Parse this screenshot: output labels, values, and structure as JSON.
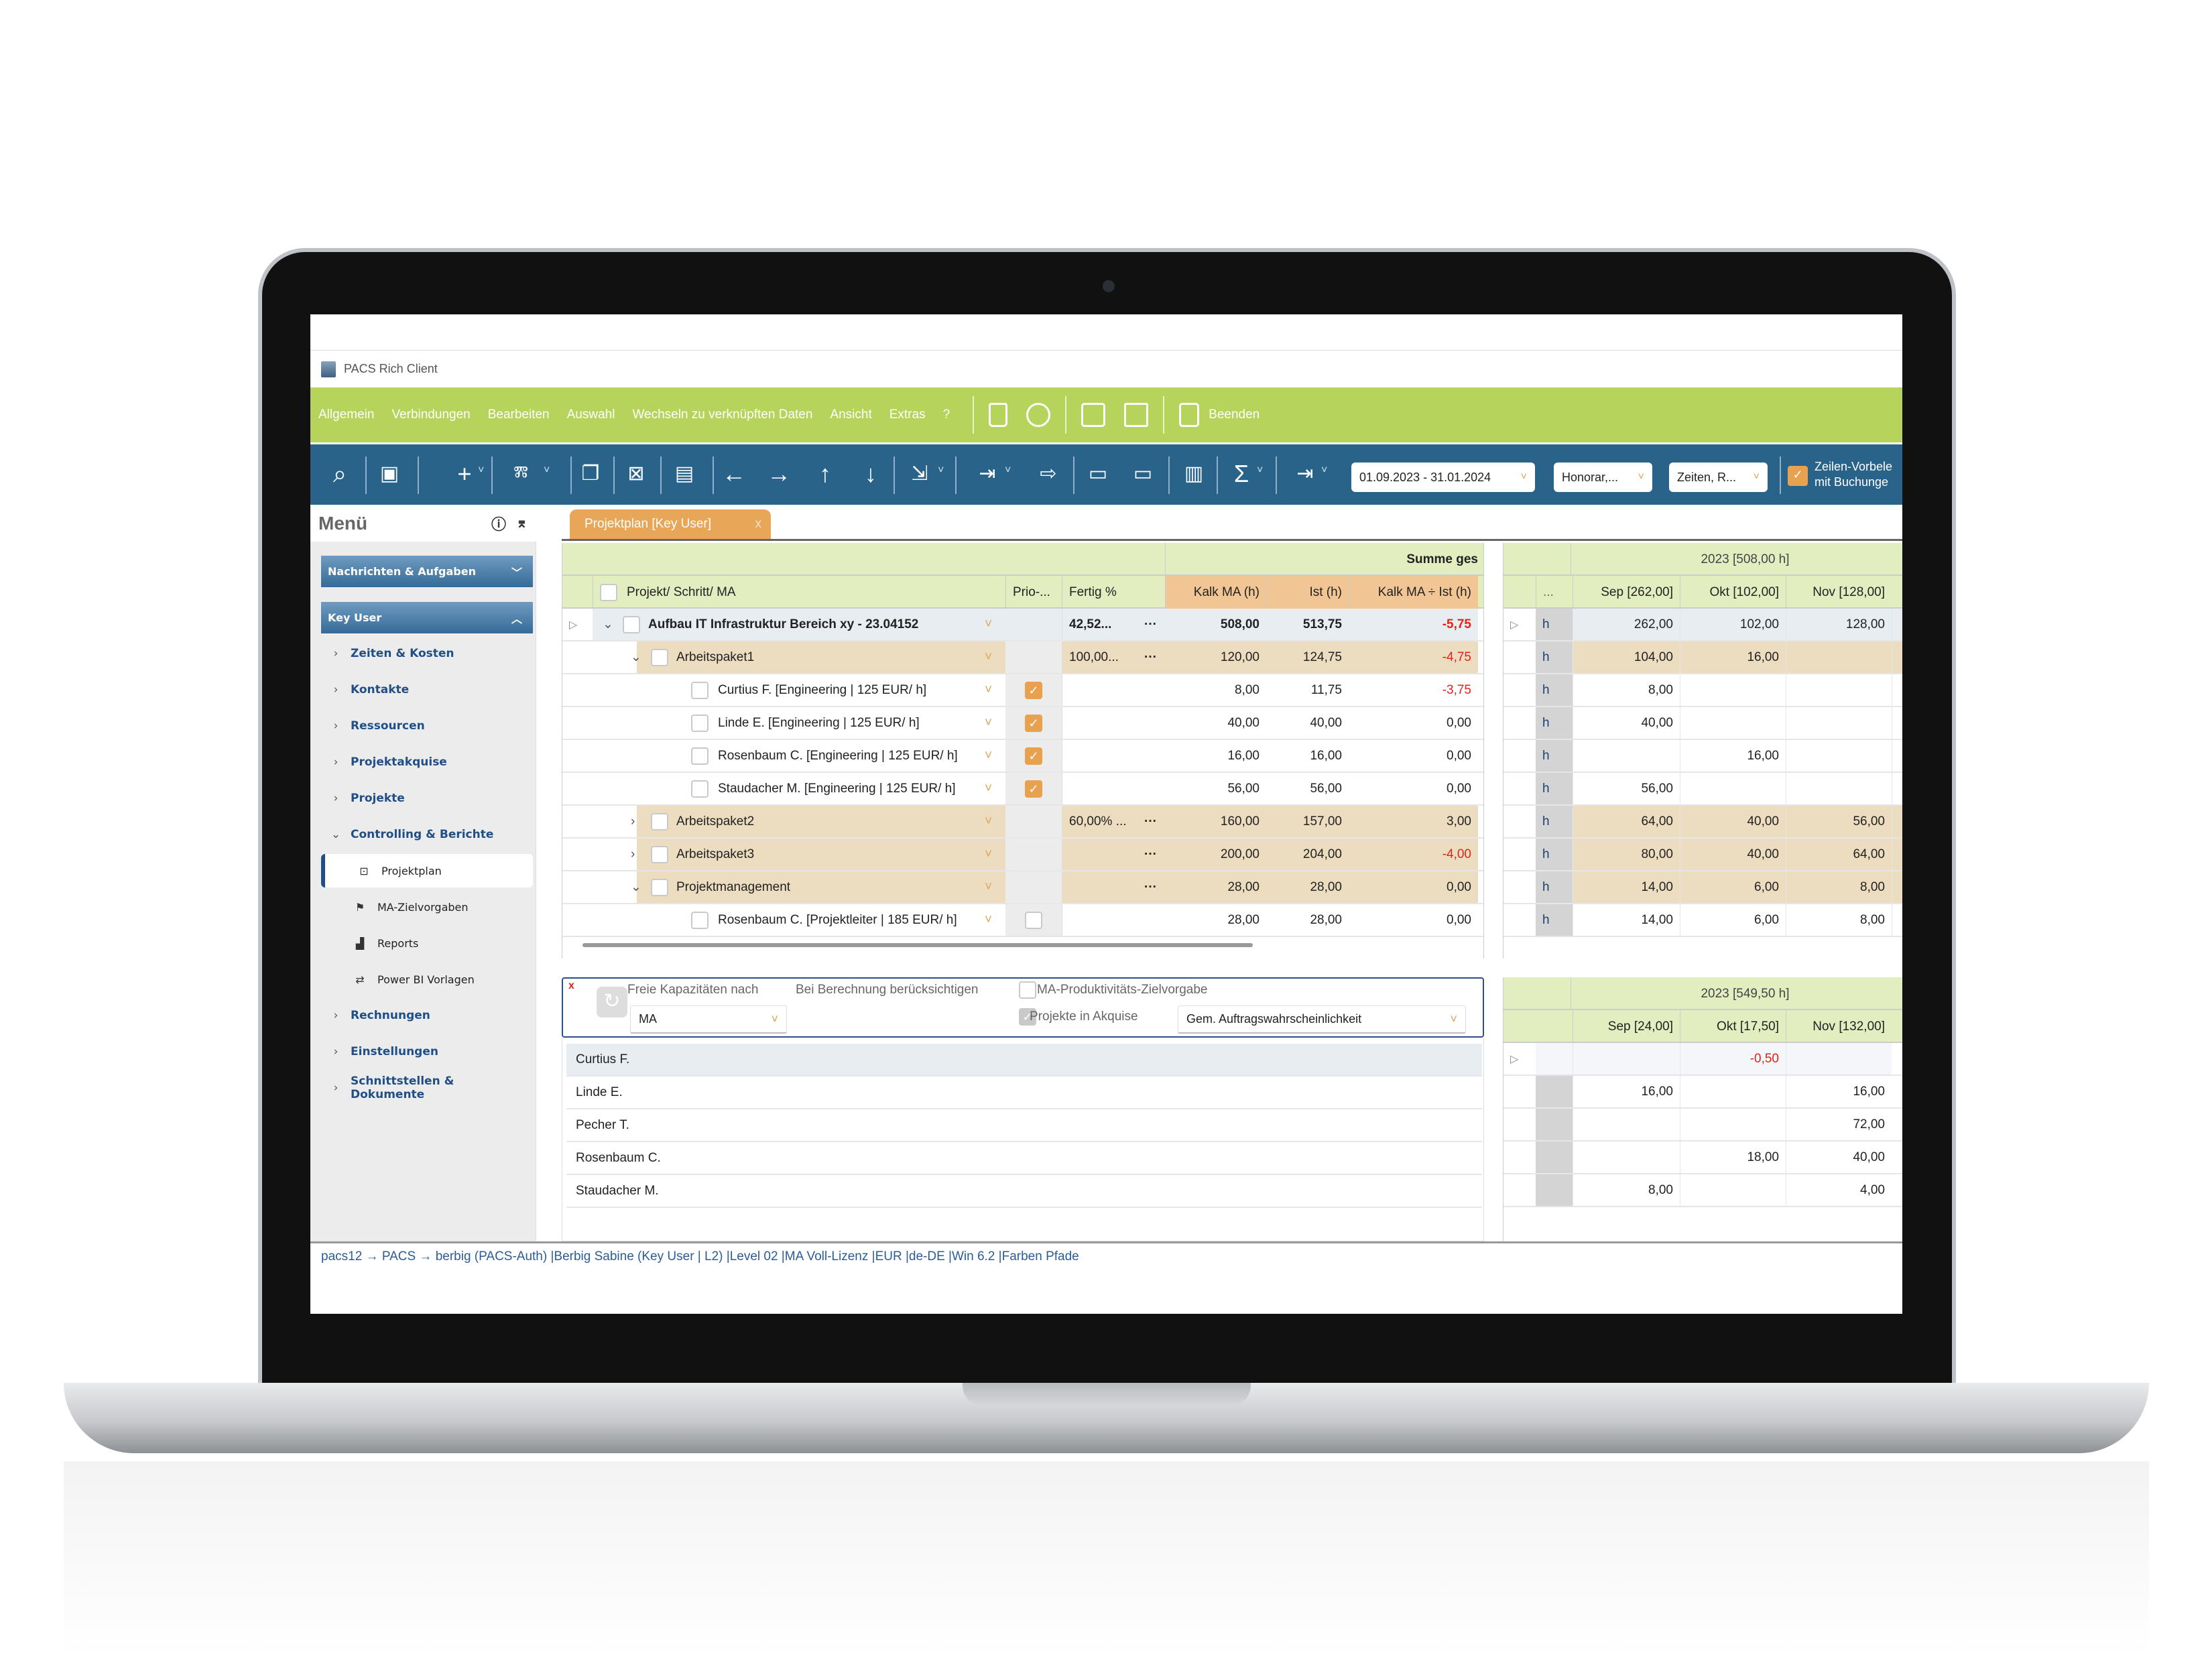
{
  "window": {
    "title": "PACS Rich Client"
  },
  "menubar": {
    "items": [
      "Allgemein",
      "Verbindungen",
      "Bearbeiten",
      "Auswahl",
      "Wechseln zu verknüpften Daten",
      "Ansicht",
      "Extras",
      "?"
    ],
    "exit_label": "Beenden",
    "icons": [
      "lock-icon",
      "globe-icon",
      "printer-icon",
      "monitor-icon",
      "exit-icon"
    ]
  },
  "toolbar": {
    "date_range": "01.09.2023 - 31.01.2024",
    "honorar": "Honorar,...",
    "zeiten": "Zeiten, R...",
    "checkbox_label_1": "Zeilen-Vorbele",
    "checkbox_label_2": "mit Buchunge",
    "checkbox_checked": true
  },
  "sidebar": {
    "title": "Menü",
    "sections": [
      "Nachrichten & Aufgaben",
      "Key User"
    ],
    "items": [
      {
        "label": "Zeiten & Kosten",
        "type": "group",
        "state": "collapsed"
      },
      {
        "label": "Kontakte",
        "type": "group",
        "state": "collapsed"
      },
      {
        "label": "Ressourcen",
        "type": "group",
        "state": "collapsed"
      },
      {
        "label": "Projektakquise",
        "type": "group",
        "state": "collapsed"
      },
      {
        "label": "Projekte",
        "type": "group",
        "state": "collapsed"
      },
      {
        "label": "Controlling & Berichte",
        "type": "group",
        "state": "expanded"
      },
      {
        "label": "Projektplan",
        "type": "sub",
        "icon": "projektplan-icon",
        "active": true
      },
      {
        "label": "MA-Zielvorgaben",
        "type": "sub",
        "icon": "flag-icon"
      },
      {
        "label": "Reports",
        "type": "sub",
        "icon": "chart-icon"
      },
      {
        "label": "Power BI Vorlagen",
        "type": "sub",
        "icon": "swap-icon"
      },
      {
        "label": "Rechnungen",
        "type": "group",
        "state": "collapsed"
      },
      {
        "label": "Einstellungen",
        "type": "group",
        "state": "collapsed"
      },
      {
        "label": "Schnittstellen & Dokumente",
        "type": "group",
        "state": "collapsed"
      }
    ]
  },
  "tab": {
    "label": "Projektplan [Key User]",
    "close": "x"
  },
  "grid": {
    "group_header": "Summe ges",
    "headers": {
      "name": "Projekt/ Schritt/ MA",
      "prio": "Prio-...",
      "fertig": "Fertig %",
      "kalk": "Kalk MA (h)",
      "ist": "Ist (h)",
      "diff": "Kalk MA ÷ Ist (h)"
    },
    "rows": [
      {
        "level": 0,
        "type": "project",
        "expand": "v",
        "name": "Aufbau IT Infrastruktur Bereich xy - 23.04152",
        "prio": "",
        "fertig": "42,52...",
        "dots": true,
        "kalk": "508,00",
        "ist": "513,75",
        "diff": "-5,75",
        "neg": true
      },
      {
        "level": 1,
        "type": "package",
        "expand": "v",
        "name": "Arbeitspaket1",
        "prio": "",
        "fertig": "100,00...",
        "dots": true,
        "kalk": "120,00",
        "ist": "124,75",
        "diff": "-4,75",
        "neg": true
      },
      {
        "level": 2,
        "type": "person",
        "expand": "",
        "name": "Curtius F. [Engineering | 125 EUR/ h]",
        "prio": "on",
        "fertig": "",
        "dots": false,
        "kalk": "8,00",
        "ist": "11,75",
        "diff": "-3,75",
        "neg": true
      },
      {
        "level": 2,
        "type": "person",
        "expand": "",
        "name": "Linde E. [Engineering | 125 EUR/ h]",
        "prio": "on",
        "fertig": "",
        "dots": false,
        "kalk": "40,00",
        "ist": "40,00",
        "diff": "0,00",
        "neg": false
      },
      {
        "level": 2,
        "type": "person",
        "expand": "",
        "name": "Rosenbaum C. [Engineering | 125 EUR/ h]",
        "prio": "on",
        "fertig": "",
        "dots": false,
        "kalk": "16,00",
        "ist": "16,00",
        "diff": "0,00",
        "neg": false
      },
      {
        "level": 2,
        "type": "person",
        "expand": "",
        "name": "Staudacher M. [Engineering | 125 EUR/ h]",
        "prio": "on",
        "fertig": "",
        "dots": false,
        "kalk": "56,00",
        "ist": "56,00",
        "diff": "0,00",
        "neg": false
      },
      {
        "level": 1,
        "type": "package",
        "expand": ">",
        "name": "Arbeitspaket2",
        "prio": "",
        "fertig": "60,00% ...",
        "dots": true,
        "kalk": "160,00",
        "ist": "157,00",
        "diff": "3,00",
        "neg": false
      },
      {
        "level": 1,
        "type": "package",
        "expand": ">",
        "name": "Arbeitspaket3",
        "prio": "",
        "fertig": "",
        "dots": true,
        "kalk": "200,00",
        "ist": "204,00",
        "diff": "-4,00",
        "neg": true
      },
      {
        "level": 1,
        "type": "package",
        "expand": "v",
        "name": "Projektmanagement",
        "prio": "",
        "fertig": "",
        "dots": true,
        "kalk": "28,00",
        "ist": "28,00",
        "diff": "0,00",
        "neg": false
      },
      {
        "level": 2,
        "type": "person",
        "expand": "",
        "name": "Rosenbaum C. [Projektleiter | 185 EUR/ h]",
        "prio": "off",
        "fertig": "",
        "dots": false,
        "kalk": "28,00",
        "ist": "28,00",
        "diff": "0,00",
        "neg": false
      }
    ]
  },
  "timegrid": {
    "year_header": "2023 [508,00 h]",
    "unit_header": "...",
    "months": [
      "Sep [262,00]",
      "Okt [102,00]",
      "Nov [128,00]"
    ],
    "unit": "h",
    "rows": [
      [
        "262,00",
        "102,00",
        "128,00"
      ],
      [
        "104,00",
        "16,00",
        ""
      ],
      [
        "8,00",
        "",
        ""
      ],
      [
        "40,00",
        "",
        ""
      ],
      [
        "",
        "16,00",
        ""
      ],
      [
        "56,00",
        "",
        ""
      ],
      [
        "64,00",
        "40,00",
        "56,00"
      ],
      [
        "80,00",
        "40,00",
        "64,00"
      ],
      [
        "14,00",
        "6,00",
        "8,00"
      ],
      [
        "14,00",
        "6,00",
        "8,00"
      ]
    ]
  },
  "capacity": {
    "label_nach": "Freie Kapazitäten nach",
    "nach_value": "MA",
    "label_beruecksichtigen": "Bei Berechnung berücksichtigen",
    "zielvorgabe_label": "MA-Produktivitäts-Zielvorgabe",
    "zielvorgabe_checked": false,
    "akquise_label": "Projekte in Akquise",
    "akquise_checked": true,
    "wahrscheinlichkeit": "Gem. Auftragswahrscheinlichkeit",
    "employees": [
      "Curtius F.",
      "Linde E.",
      "Pecher T.",
      "Rosenbaum C.",
      "Staudacher M."
    ],
    "year_header": "2023 [549,50 h]",
    "months": [
      "Sep [24,00]",
      "Okt [17,50]",
      "Nov [132,00]"
    ],
    "rows": [
      [
        "",
        "-0,50",
        ""
      ],
      [
        "16,00",
        "",
        "16,00"
      ],
      [
        "",
        "",
        "72,00"
      ],
      [
        "",
        "18,00",
        "40,00"
      ],
      [
        "8,00",
        "",
        "4,00"
      ]
    ]
  },
  "statusbar": {
    "text": "pacs12 → PACS → berbig (PACS-Auth)  |Berbig Sabine (Key User | L2)  |Level 02  |MA Voll-Lizenz  |EUR  |de-DE  |Win 6.2  |Farben    Pfade"
  },
  "colors": {
    "menubar": "#b6d35b",
    "toolbar": "#2a6389",
    "accent": "#e8a658",
    "package_row": "#ecdcc0",
    "header": "#e2edc0",
    "negative": "#e0231b"
  }
}
